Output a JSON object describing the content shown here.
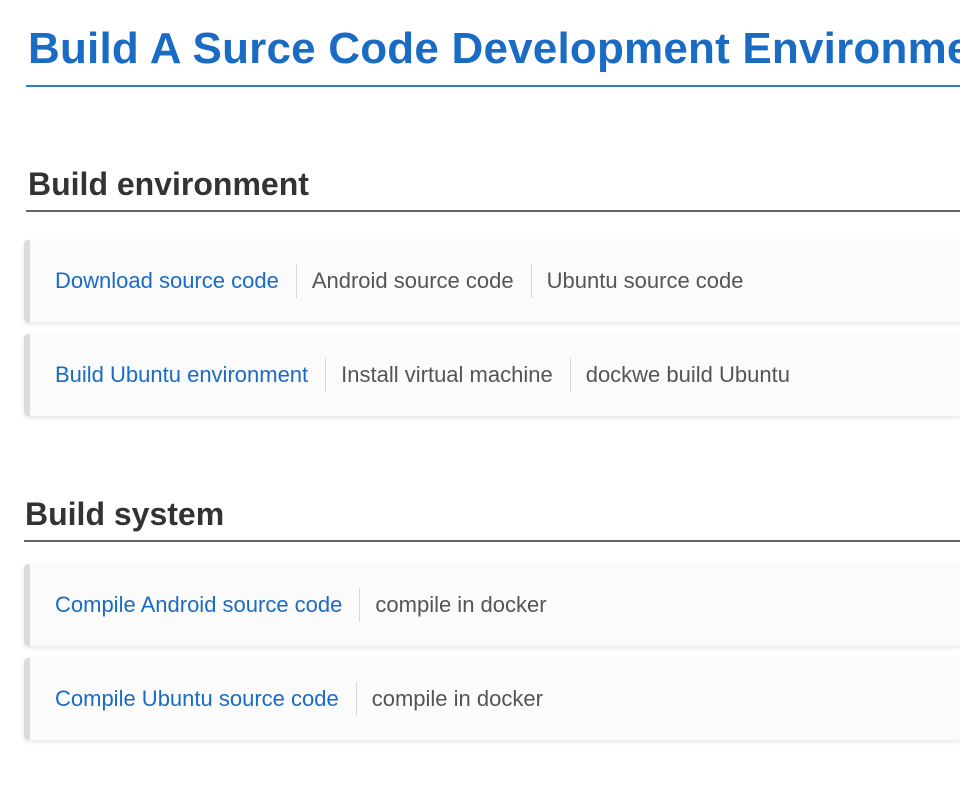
{
  "page": {
    "title": "Build A Surce Code Development Environment"
  },
  "sections": [
    {
      "heading": "Build environment",
      "rows": [
        {
          "link": "Download source code",
          "items": [
            "Android source code",
            "Ubuntu source code"
          ]
        },
        {
          "link": "Build Ubuntu environment",
          "items": [
            "Install virtual machine",
            "dockwe build Ubuntu"
          ]
        }
      ]
    },
    {
      "heading": "Build system",
      "rows": [
        {
          "link": "Compile Android source code",
          "items": [
            "compile in docker"
          ]
        },
        {
          "link": "Compile Ubuntu source code",
          "items": [
            "compile in docker"
          ]
        }
      ]
    }
  ],
  "colors": {
    "title": "#1a6bc4",
    "link": "#1a6bc4",
    "heading": "#333333",
    "item_text": "#555555"
  }
}
